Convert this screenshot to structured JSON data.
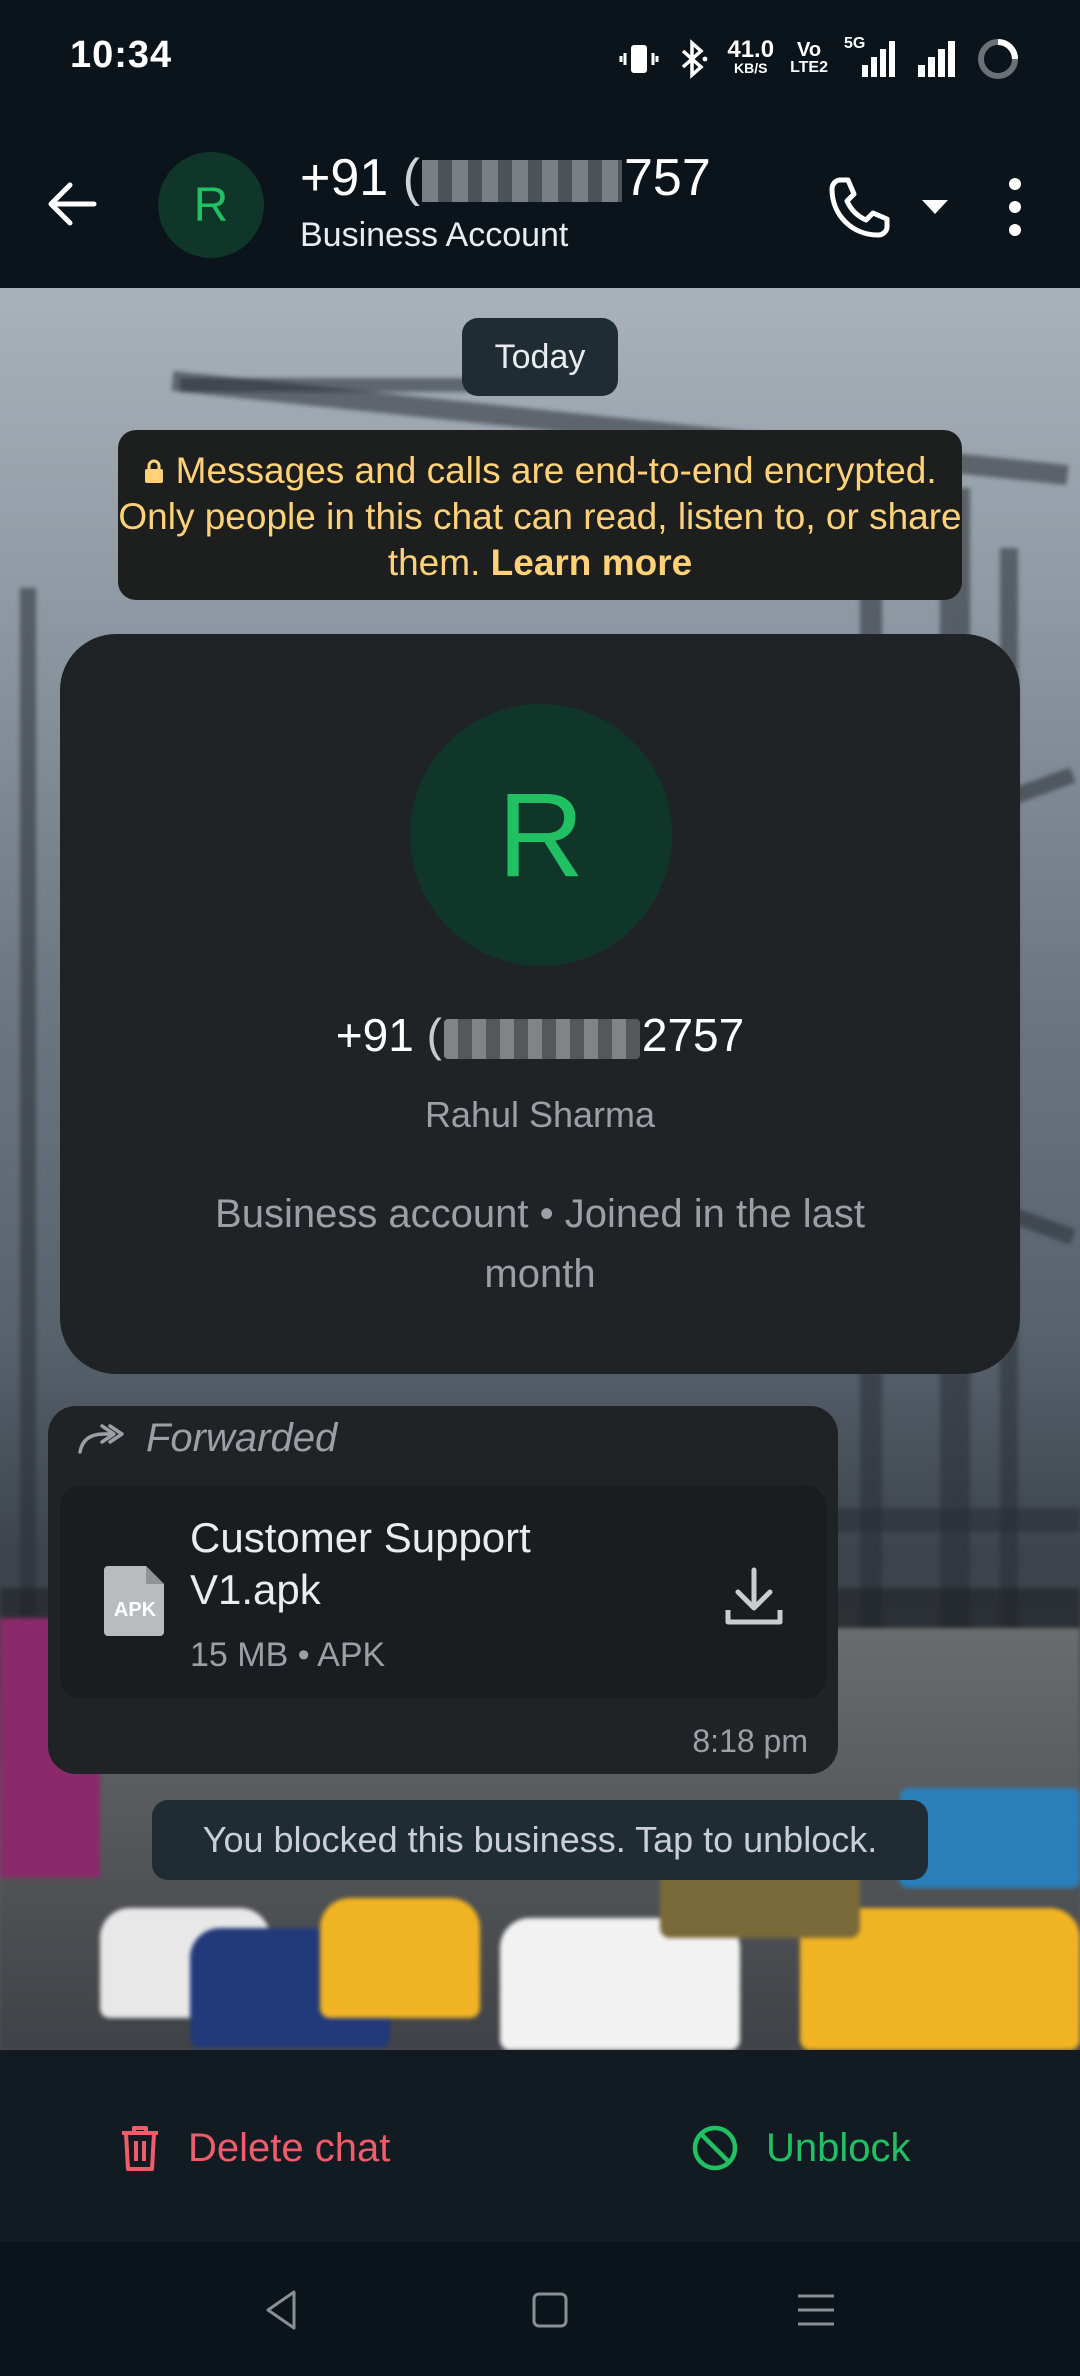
{
  "status_bar": {
    "time": "10:34",
    "net_speed": "41.0",
    "net_unit": "KB/S",
    "volte_top": "Vo",
    "volte_bottom": "LTE2",
    "net_type": "5G"
  },
  "header": {
    "avatar_letter": "R",
    "phone_prefix": "+91",
    "phone_suffix": "757",
    "phone_partial": "(",
    "subtitle": "Business Account"
  },
  "chat": {
    "date_chip": "Today",
    "encryption_notice": "Messages and calls are end-to-end encrypted. Only people in this chat can read, listen to, or share them.",
    "learn_more": "Learn more",
    "profile_card": {
      "avatar_letter": "R",
      "phone_prefix": "+91",
      "phone_open": "(",
      "phone_suffix": "2757",
      "name": "Rahul Sharma",
      "info": "Business account • Joined in the last month"
    },
    "message": {
      "forwarded_label": "Forwarded",
      "file_name": "Customer Support V1.apk",
      "file_meta": "15 MB • APK",
      "file_icon_label": "APK",
      "time": "8:18 pm"
    },
    "blocked_notice": "You blocked this business. Tap to unblock."
  },
  "actions": {
    "delete_label": "Delete chat",
    "unblock_label": "Unblock"
  },
  "colors": {
    "accent_green": "#21c063",
    "danger_red": "#f15c6d",
    "notice_yellow": "#ffd279",
    "background": "#0b141a"
  },
  "icons": [
    "back-arrow-icon",
    "phone-icon",
    "dropdown-icon",
    "more-vert-icon",
    "lock-icon",
    "forward-icon",
    "apk-file-icon",
    "download-icon",
    "trash-icon",
    "block-icon",
    "nav-back-icon",
    "nav-home-icon",
    "nav-recents-icon"
  ]
}
